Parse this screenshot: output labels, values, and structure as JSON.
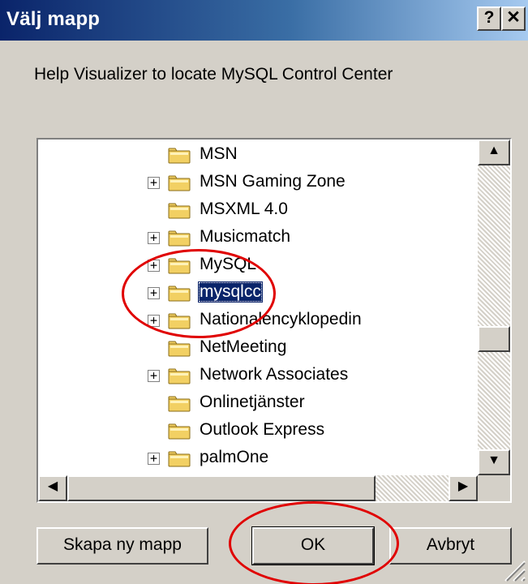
{
  "window": {
    "title": "Välj mapp",
    "help_label": "?",
    "close_label": "✕"
  },
  "prompt": "Help Visualizer to locate MySQL Control Center",
  "tree": {
    "items": [
      {
        "label": "MSN",
        "expandable": false,
        "selected": false
      },
      {
        "label": "MSN Gaming Zone",
        "expandable": true,
        "selected": false
      },
      {
        "label": "MSXML 4.0",
        "expandable": false,
        "selected": false
      },
      {
        "label": "Musicmatch",
        "expandable": true,
        "selected": false
      },
      {
        "label": "MySQL",
        "expandable": true,
        "selected": false
      },
      {
        "label": "mysqlcc",
        "expandable": true,
        "selected": true
      },
      {
        "label": "Nationalencyklopedin",
        "expandable": true,
        "selected": false
      },
      {
        "label": "NetMeeting",
        "expandable": false,
        "selected": false
      },
      {
        "label": "Network Associates",
        "expandable": true,
        "selected": false
      },
      {
        "label": "Onlinetjänster",
        "expandable": false,
        "selected": false
      },
      {
        "label": "Outlook Express",
        "expandable": false,
        "selected": false
      },
      {
        "label": "palmOne",
        "expandable": true,
        "selected": false
      }
    ],
    "expand_glyph": "+"
  },
  "scrollbar": {
    "up": "▲",
    "down": "▼",
    "left": "◀",
    "right": "▶"
  },
  "buttons": {
    "new_folder": "Skapa ny mapp",
    "ok": "OK",
    "cancel": "Avbryt"
  },
  "colors": {
    "selection": "#0a246a",
    "annotation": "#e00000",
    "folder": "#f2d063"
  }
}
